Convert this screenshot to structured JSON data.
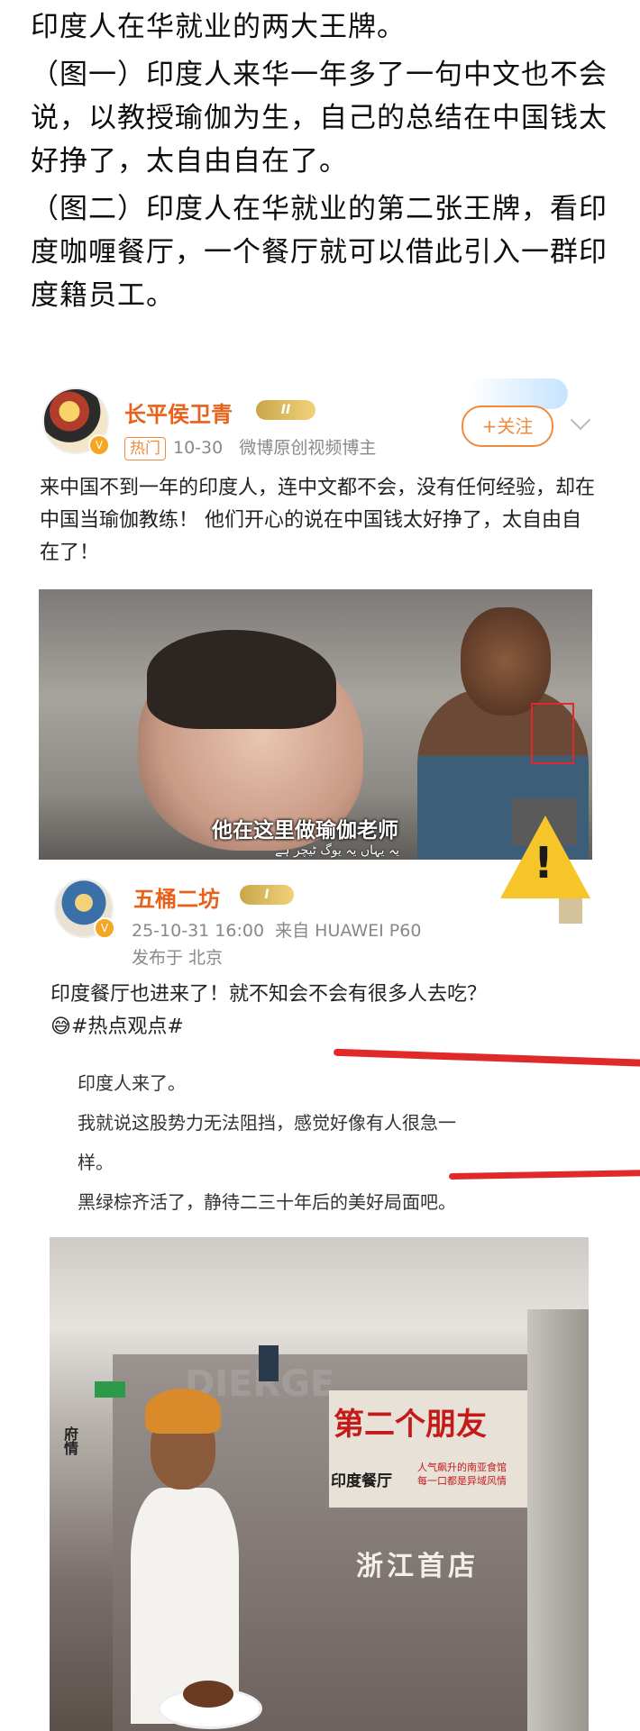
{
  "intro": {
    "line1": "印度人在华就业的两大王牌。",
    "line2": "（图一）印度人来华一年多了一句中文也不会说，以教授瑜伽为生，自己的总结在中国钱太好挣了，太自由自在了。",
    "line3": "（图二）印度人在华就业的第二张王牌，看印度咖喱餐厅，一个餐厅就可以借此引入一群印度籍员工。"
  },
  "post1": {
    "username": "长平侯卫青",
    "level": "II",
    "hot_tag": "热门",
    "date": "10-30",
    "role": "微博原创视频博主",
    "follow_label": "+关注",
    "text": "来中国不到一年的印度人，连中文都不会，没有任何经验，却在中国当瑜伽教练！ 他们开心的说在中国钱太好挣了，太自由自在了！",
    "video_caption": "他在这里做瑜伽老师",
    "video_caption_sub": "یہ یہاں یہ یوگ ٹیچر ہے"
  },
  "warning": {
    "mark": "!"
  },
  "post2": {
    "username": "五桶二坊",
    "level": "I",
    "time": "25-10-31 16:00",
    "source": "来自 HUAWEI P60",
    "location": "发布于 北京",
    "text": "印度餐厅也进来了！就不知会不会有很多人去吃？",
    "emoji": "😅",
    "hashtag": "#热点观点#",
    "quote": [
      "印度人来了。",
      "我就说这股势力无法阻挡，感觉好像有人很急一",
      "样。",
      "黑绿棕齐活了，静待二三十年后的美好局面吧。"
    ],
    "photo": {
      "banner_title": "第二个朋友",
      "banner_sub": "印度餐厅",
      "banner_sub2a": "人气飙升的南亚食馆",
      "banner_sub2b": "每一口都是异域风情",
      "store_label": "浙江首店",
      "side_text": "府情",
      "bg_text": "DIERGE"
    }
  }
}
